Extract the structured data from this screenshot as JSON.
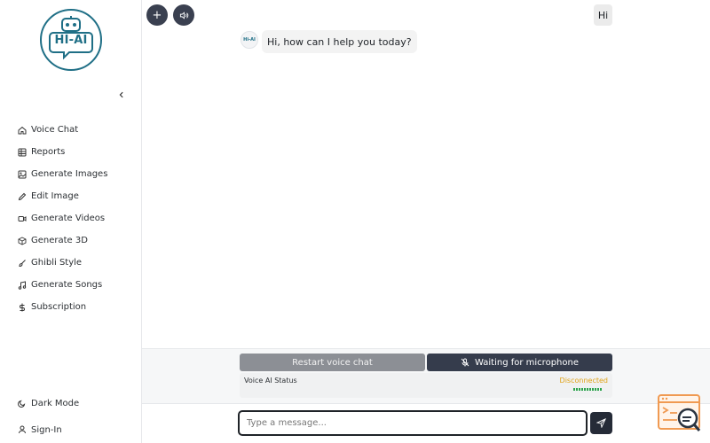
{
  "logo": {
    "text": "HI-AI"
  },
  "sidebar": {
    "collapse_icon": "chevron-left-icon",
    "items": [
      {
        "label": "Voice Chat",
        "icon": "home-icon"
      },
      {
        "label": "Reports",
        "icon": "table-icon"
      },
      {
        "label": "Generate Images",
        "icon": "image-icon"
      },
      {
        "label": "Edit Image",
        "icon": "pencil-icon"
      },
      {
        "label": "Generate Videos",
        "icon": "video-icon"
      },
      {
        "label": "Generate 3D",
        "icon": "cube-icon"
      },
      {
        "label": "Ghibli Style",
        "icon": "brush-icon"
      },
      {
        "label": "Generate Songs",
        "icon": "music-icon"
      },
      {
        "label": "Subscription",
        "icon": "dollar-icon"
      }
    ],
    "bottom_items": [
      {
        "label": "Dark Mode",
        "icon": "moon-icon"
      },
      {
        "label": "Sign-In",
        "icon": "user-icon"
      }
    ]
  },
  "topbar": {
    "add_label": "+",
    "sound_icon": "speaker-icon"
  },
  "chat": {
    "user_message": "Hi",
    "bot_avatar_text": "Hi-AI",
    "bot_message": "Hi, how can I help you today?"
  },
  "voice": {
    "restart_label": "Restart voice chat",
    "mic_label": "Waiting for microphone",
    "status_label": "Voice AI Status",
    "status_value": "Disconnected",
    "status_color": "#e0a318"
  },
  "composer": {
    "placeholder": "Type a message...",
    "value": ""
  },
  "colors": {
    "accent": "#353c4c",
    "brand": "#1f6f86"
  }
}
